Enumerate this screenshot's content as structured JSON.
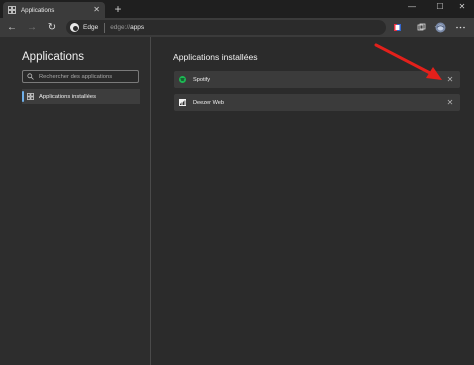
{
  "browser": {
    "tab": {
      "label": "Applications",
      "close": "✕"
    },
    "new_tab": "+",
    "window": {
      "minimize": "—",
      "maximize": "☐",
      "close": "✕"
    },
    "nav": {
      "back": "←",
      "forward": "→",
      "refresh": "↻"
    },
    "address": {
      "site_label": "Edge",
      "scheme": "edge://",
      "path": "apps"
    },
    "favorite": "☆"
  },
  "sidebar": {
    "title": "Applications",
    "search_placeholder": "Rechercher des applications",
    "items": [
      {
        "label": "Applications installées",
        "selected": true
      }
    ]
  },
  "main": {
    "title": "Applications installées",
    "apps": [
      {
        "name": "Spotify",
        "icon": "spotify-icon",
        "remove": "✕"
      },
      {
        "name": "Deezer Web",
        "icon": "deezer-icon",
        "remove": "✕"
      }
    ]
  },
  "colors": {
    "accent": "#6fb0ea",
    "annotation_arrow": "#e3201b",
    "spotify": "#1db954"
  }
}
